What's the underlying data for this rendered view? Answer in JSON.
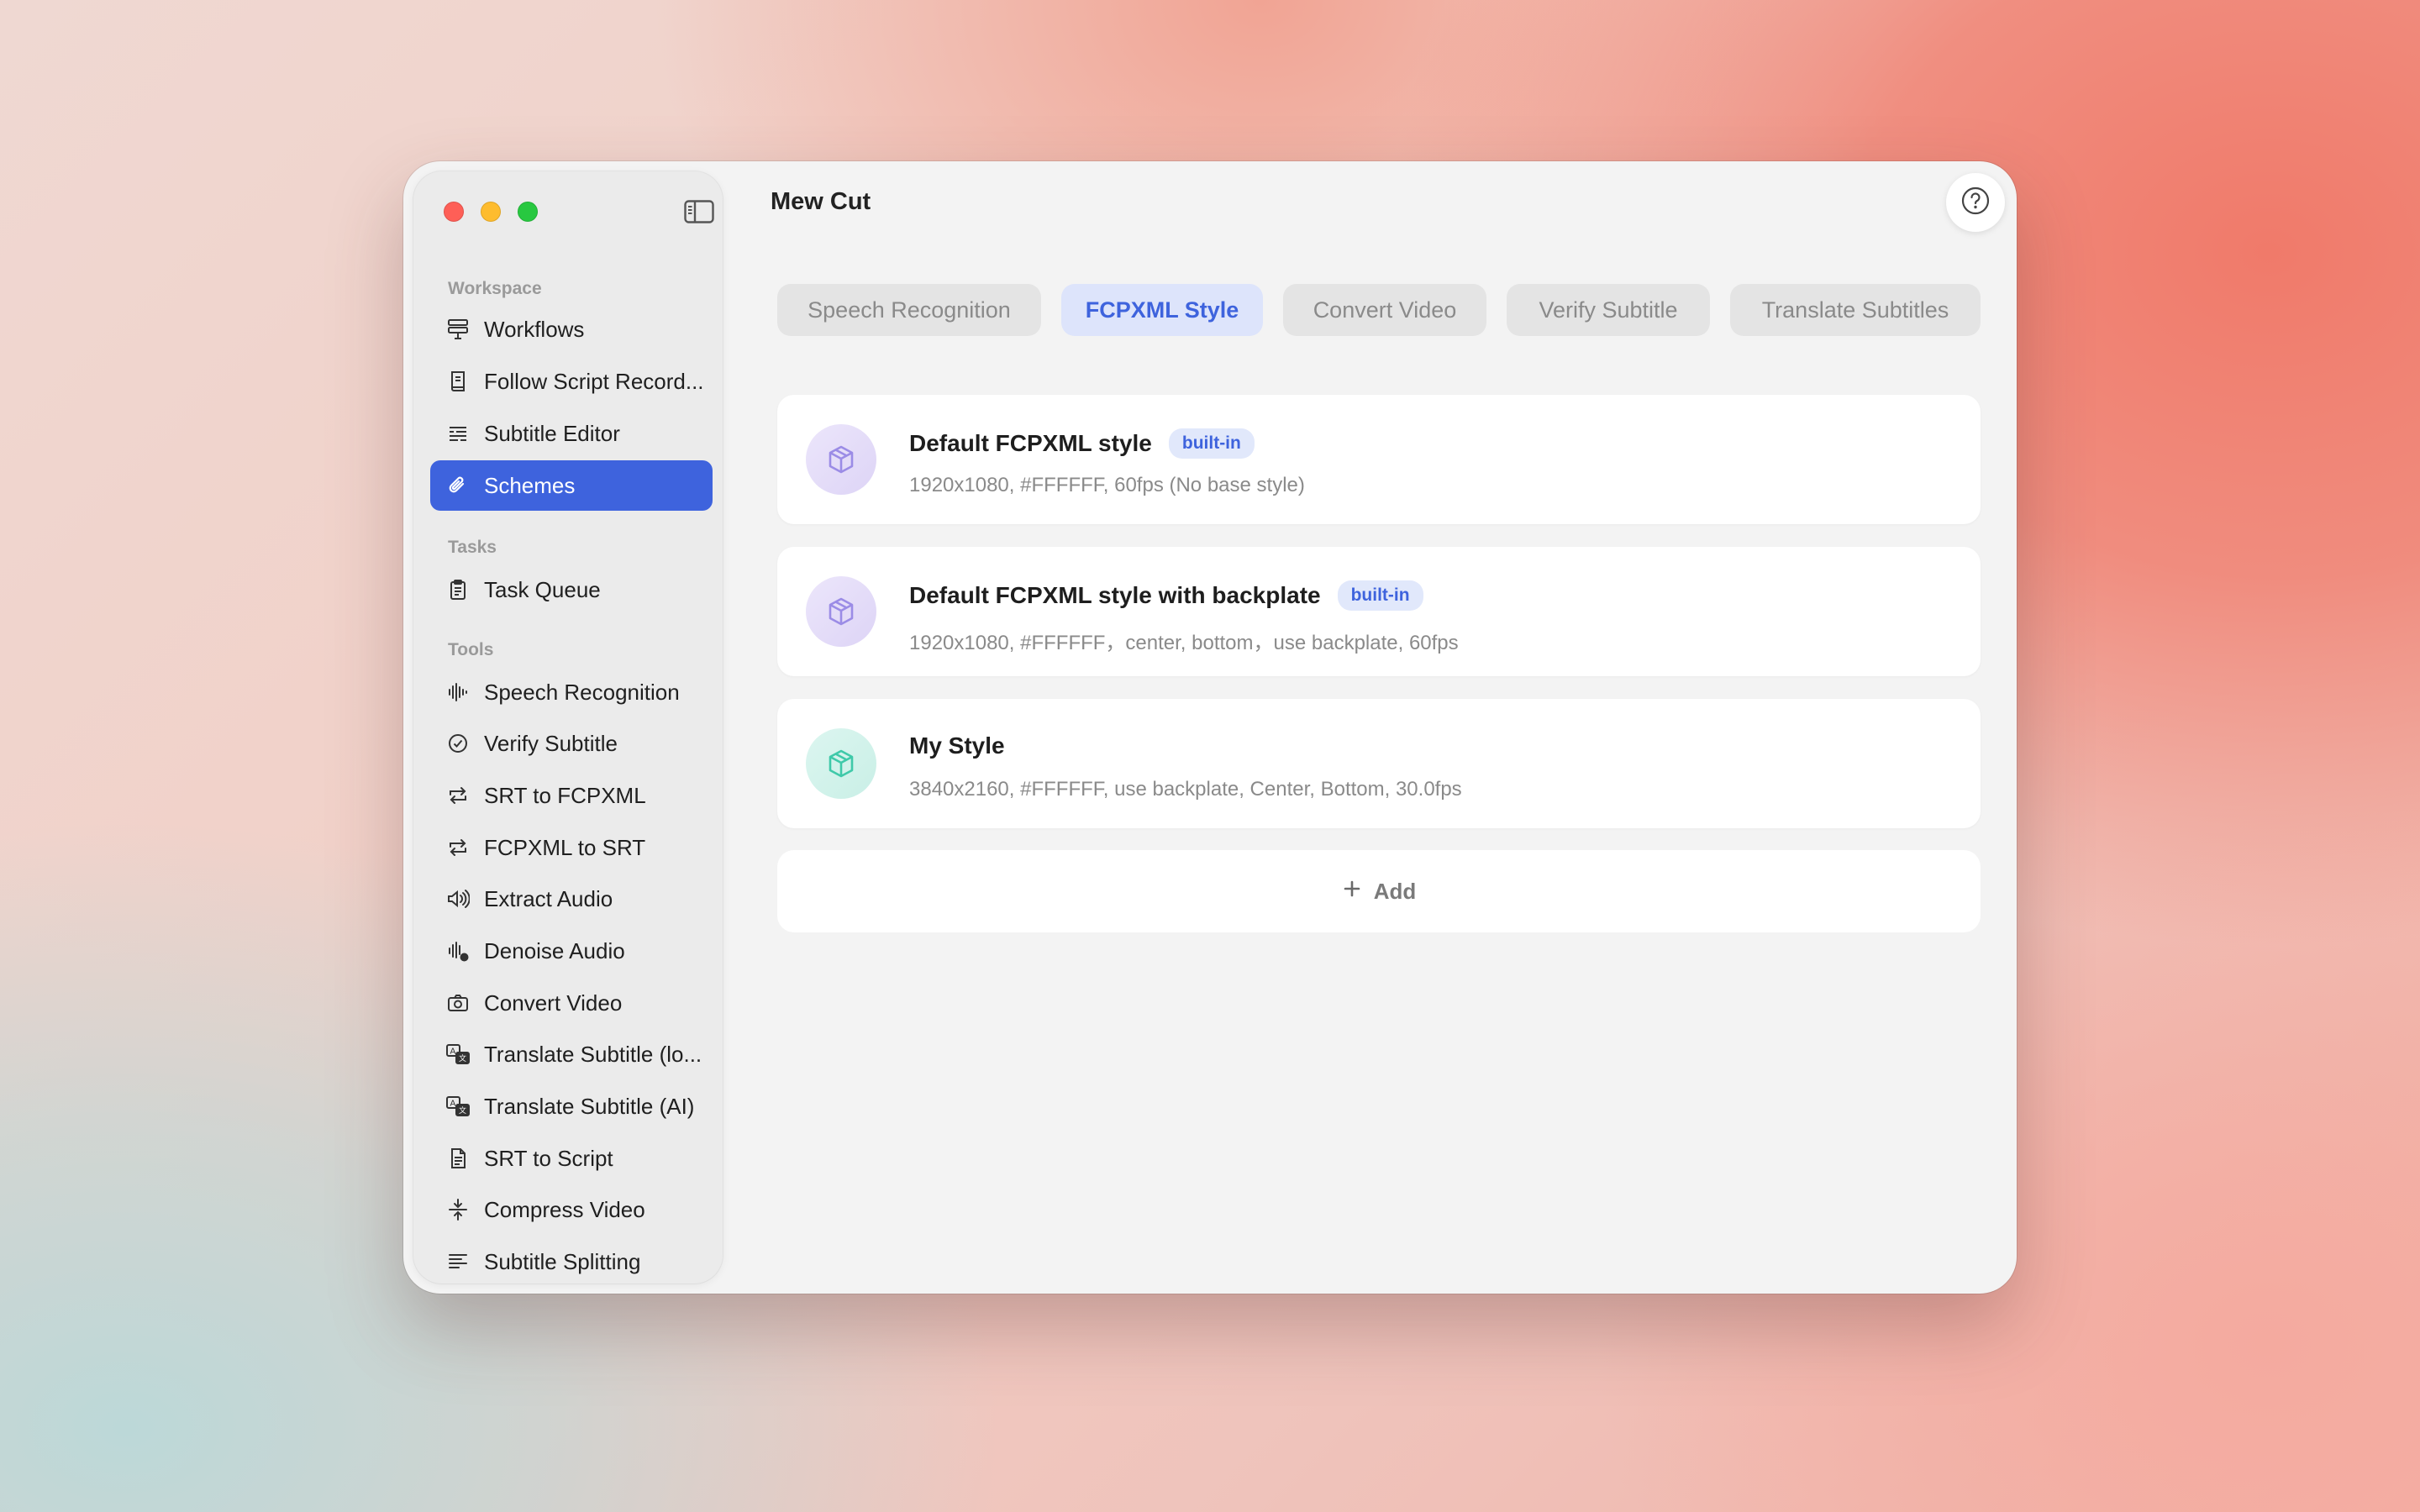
{
  "app": {
    "title": "Mew Cut"
  },
  "sidebar": {
    "sections": {
      "workspace": "Workspace",
      "tasks": "Tasks",
      "tools": "Tools"
    },
    "items": [
      {
        "label": "Workflows",
        "icon": "workflows-icon"
      },
      {
        "label": "Follow Script Record...",
        "icon": "script-book-icon"
      },
      {
        "label": "Subtitle Editor",
        "icon": "subtitle-lines-icon"
      },
      {
        "label": "Schemes",
        "icon": "paperclip-icon",
        "active": true
      },
      {
        "label": "Task Queue",
        "icon": "clipboard-icon"
      },
      {
        "label": "Speech Recognition",
        "icon": "waveform-icon"
      },
      {
        "label": "Verify Subtitle",
        "icon": "checkmark-circle-icon"
      },
      {
        "label": "SRT to FCPXML",
        "icon": "convert-arrows-icon"
      },
      {
        "label": "FCPXML to SRT",
        "icon": "convert-arrows-icon"
      },
      {
        "label": "Extract Audio",
        "icon": "speaker-icon"
      },
      {
        "label": "Denoise Audio",
        "icon": "denoise-waveform-icon"
      },
      {
        "label": "Convert Video",
        "icon": "camera-icon"
      },
      {
        "label": "Translate Subtitle (lo...",
        "icon": "translate-icon"
      },
      {
        "label": "Translate Subtitle (AI)",
        "icon": "translate-icon"
      },
      {
        "label": "SRT to Script",
        "icon": "document-icon"
      },
      {
        "label": "Compress Video",
        "icon": "compress-icon"
      },
      {
        "label": "Subtitle Splitting",
        "icon": "text-align-icon"
      }
    ]
  },
  "tabs": [
    {
      "label": "Speech Recognition"
    },
    {
      "label": "FCPXML Style",
      "active": true
    },
    {
      "label": "Convert Video"
    },
    {
      "label": "Verify Subtitle"
    },
    {
      "label": "Translate Subtitles"
    }
  ],
  "schemes": [
    {
      "name": "Default FCPXML style",
      "tag": "built-in",
      "desc": "1920x1080, #FFFFFF, 60fps (No base style)",
      "icon_color": "#9b8ce6"
    },
    {
      "name": "Default FCPXML style with backplate",
      "tag": "built-in",
      "desc": "1920x1080, #FFFFFF，center, bottom，use backplate, 60fps",
      "icon_color": "#9b8ce6"
    },
    {
      "name": "My Style",
      "tag": "",
      "desc": "3840x2160, #FFFFFF, use backplate, Center, Bottom, 30.0fps",
      "icon_color": "#3fc9a9"
    }
  ],
  "add_button": {
    "label": "Add"
  },
  "colors": {
    "accent": "#3E63DD",
    "sidebar_bg": "#EBEBEB",
    "window_bg": "#F3F3F3"
  }
}
